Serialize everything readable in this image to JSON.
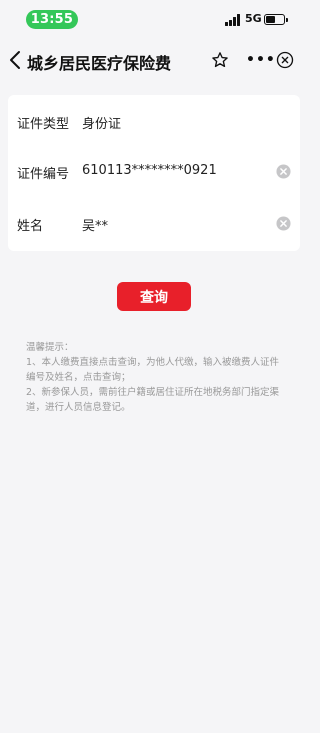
{
  "status_bar": {
    "time": "13:55",
    "network": "5G"
  },
  "nav": {
    "title": "城乡居民医疗保险费",
    "more_label": "•••"
  },
  "form": {
    "rows": [
      {
        "label": "证件类型",
        "value": "身份证"
      },
      {
        "label": "证件编号",
        "value": "610113********0921"
      },
      {
        "label": "姓名",
        "value": "吴**"
      }
    ]
  },
  "query_button": {
    "label": "查询"
  },
  "tips": {
    "title": "温馨提示：",
    "line1": "1、本人缴费直接点击查询，为他人代缴，输入被缴费人证件编号及姓名，点击查询；",
    "line2": "2、新参保人员，需前往户籍或居住证所在地税务部门指定渠道，进行人员信息登记。"
  },
  "colors": {
    "accent": "#e8202a",
    "time_pill": "#34c759"
  }
}
